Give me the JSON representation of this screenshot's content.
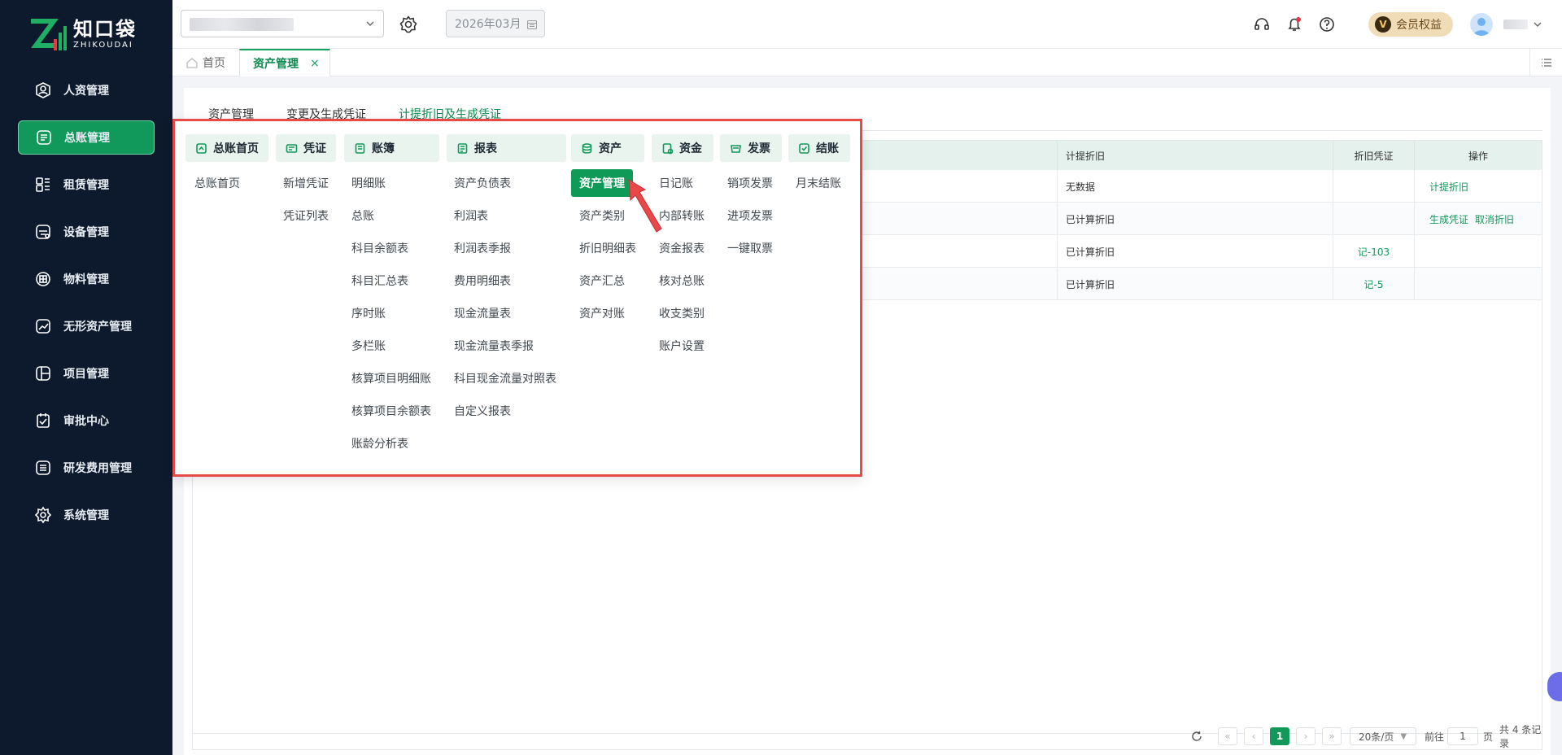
{
  "brand": {
    "name_cn": "知口袋",
    "name_en": "ZHIKOUDAI"
  },
  "sidebar": {
    "items": [
      {
        "label": "人资管理",
        "icon": "person-badge-icon"
      },
      {
        "label": "总账管理",
        "icon": "ledger-icon",
        "active": true
      },
      {
        "label": "租赁管理",
        "icon": "lease-icon"
      },
      {
        "label": "设备管理",
        "icon": "device-icon"
      },
      {
        "label": "物料管理",
        "icon": "material-icon"
      },
      {
        "label": "无形资产管理",
        "icon": "intangible-asset-icon"
      },
      {
        "label": "项目管理",
        "icon": "project-icon"
      },
      {
        "label": "审批中心",
        "icon": "approval-icon"
      },
      {
        "label": "研发费用管理",
        "icon": "rd-expense-icon"
      },
      {
        "label": "系统管理",
        "icon": "settings-icon"
      }
    ]
  },
  "header": {
    "month": "2026年03月",
    "member_label": "会员权益",
    "member_badge": "V"
  },
  "tabs": {
    "home": "首页",
    "active": "资产管理",
    "close": "×"
  },
  "subtabs": [
    "资产管理",
    "变更及生成凭证",
    "计提折旧及生成凭证"
  ],
  "table": {
    "headers": {
      "depreciation": "计提折旧",
      "voucher": "折旧凭证",
      "operation": "操作"
    },
    "rows": [
      {
        "depreciation": "无数据",
        "voucher": "",
        "ops": [
          "计提折旧"
        ]
      },
      {
        "depreciation": "已计算折旧",
        "voucher": "",
        "ops": [
          "生成凭证",
          "取消折旧"
        ]
      },
      {
        "depreciation": "已计算折旧",
        "voucher": "记-103",
        "ops": []
      },
      {
        "depreciation": "已计算折旧",
        "voucher": "记-5",
        "ops": []
      }
    ]
  },
  "pager": {
    "current": "1",
    "page_size": "20条/页",
    "goto_prefix": "前往",
    "goto_value": "1",
    "goto_suffix": "页",
    "total": "共 4 条记录"
  },
  "menu": {
    "categories": [
      {
        "label": "总账首页",
        "icon": "home-ledger-icon",
        "items": [
          "总账首页"
        ]
      },
      {
        "label": "凭证",
        "icon": "voucher-icon",
        "items": [
          "新增凭证",
          "凭证列表"
        ]
      },
      {
        "label": "账簿",
        "icon": "book-icon",
        "items": [
          "明细账",
          "总账",
          "科目余额表",
          "科目汇总表",
          "序时账",
          "多栏账",
          "核算项目明细账",
          "核算项目余额表",
          "账龄分析表"
        ]
      },
      {
        "label": "报表",
        "icon": "report-icon",
        "items": [
          "资产负债表",
          "利润表",
          "利润表季报",
          "费用明细表",
          "现金流量表",
          "现金流量表季报",
          "科目现金流量对照表",
          "自定义报表"
        ]
      },
      {
        "label": "资产",
        "icon": "asset-icon",
        "items": [
          "资产管理",
          "资产类别",
          "折旧明细表",
          "资产汇总",
          "资产对账"
        ]
      },
      {
        "label": "资金",
        "icon": "fund-icon",
        "items": [
          "日记账",
          "内部转账",
          "资金报表",
          "核对总账",
          "收支类别",
          "账户设置"
        ]
      },
      {
        "label": "发票",
        "icon": "invoice-icon",
        "items": [
          "销项发票",
          "进项发票",
          "一键取票"
        ]
      },
      {
        "label": "结账",
        "icon": "closing-icon",
        "items": [
          "月末结账"
        ]
      }
    ]
  },
  "colors": {
    "brand_green": "#12995a",
    "sidebar_bg": "#0d1a2e",
    "highlight_border": "#e84949"
  }
}
